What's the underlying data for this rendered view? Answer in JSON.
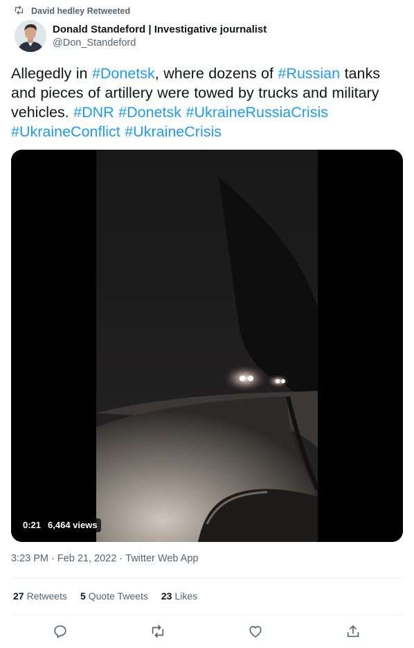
{
  "retweet": {
    "text": "David hedley Retweeted",
    "icon": "retweet-icon"
  },
  "author": {
    "name": "Donald Standeford | Investigative journalist",
    "handle": "@Don_Standeford"
  },
  "tweet": {
    "text_1": "Allegedly in ",
    "tag_1": "#Donetsk",
    "text_2": ", where dozens of ",
    "tag_2": "#Russian",
    "text_3": " tanks and pieces of artillery were towed by trucks and military vehicles. ",
    "tag_3": "#DNR",
    "tag_4": "#Donetsk",
    "tag_5": "#UkraineRussiaCrisis",
    "tag_6": "#UkraineConflict",
    "tag_7": "#UkraineCrisis"
  },
  "video": {
    "duration": "0:21",
    "views": "6,464 views"
  },
  "meta": {
    "time": "3:23 PM",
    "sep": "·",
    "date": "Feb 21, 2022",
    "source": "Twitter Web App"
  },
  "stats": {
    "retweets_count": "27",
    "retweets_label": "Retweets",
    "quotes_count": "5",
    "quotes_label": "Quote Tweets",
    "likes_count": "23",
    "likes_label": "Likes"
  },
  "actions": [
    "reply-icon",
    "retweet-icon",
    "like-icon",
    "share-icon"
  ],
  "colors": {
    "accent": "#1d9bf0",
    "text": "#0f1419",
    "secondary": "#536471",
    "divider": "#eff3f4"
  }
}
